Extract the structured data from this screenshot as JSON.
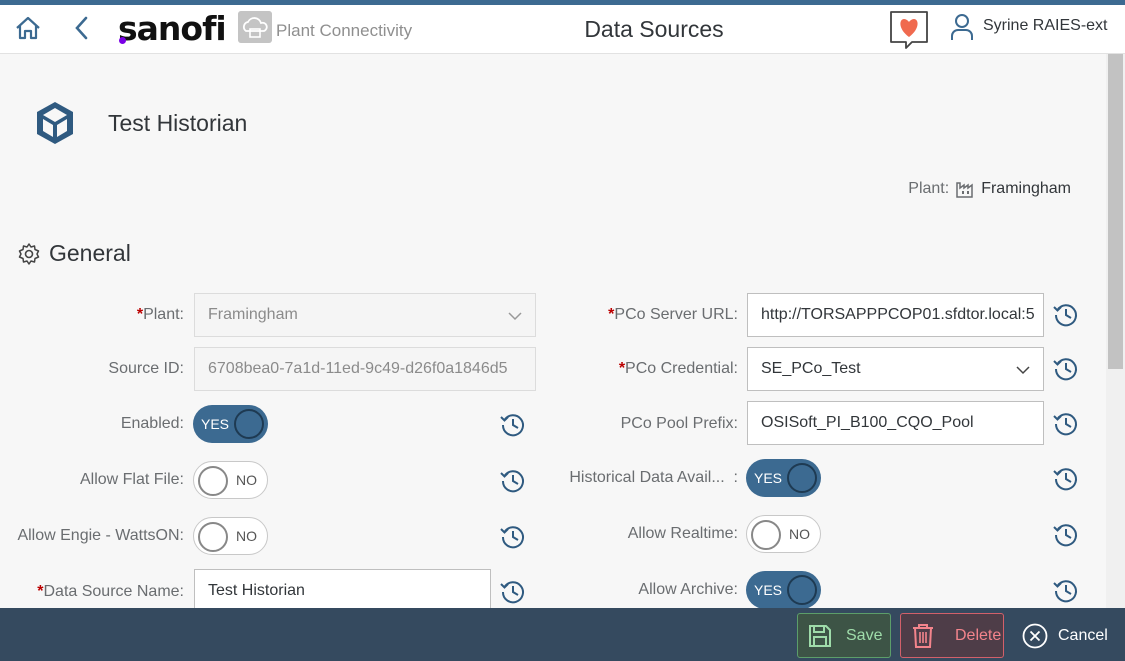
{
  "header": {
    "logo_text": "sanofi",
    "app_name": "Plant Connectivity",
    "title": "Data Sources",
    "user_name": "Syrine RAIES-ext"
  },
  "object": {
    "title": "Test Historian",
    "plant_label": "Plant:",
    "plant_value": "Framingham"
  },
  "section": {
    "title": "General"
  },
  "left_fields": {
    "plant": {
      "label": "Plant:",
      "value": "Framingham"
    },
    "source_id": {
      "label": "Source ID:",
      "value": "6708bea0-7a1d-11ed-9c49-d26f0a1846d5"
    },
    "enabled": {
      "label": "Enabled:",
      "state": "YES"
    },
    "allow_flat_file": {
      "label": "Allow Flat File:",
      "state": "NO"
    },
    "allow_engie": {
      "label": "Allow Engie - WattsON:",
      "state": "NO"
    },
    "data_source_name": {
      "label": "Data Source Name:",
      "value": "Test Historian"
    }
  },
  "right_fields": {
    "pco_server_url": {
      "label": "PCo Server URL:",
      "value": "http://TORSAPPPCOP01.sfdtor.local:5"
    },
    "pco_credential": {
      "label": "PCo Credential:",
      "value": "SE_PCo_Test"
    },
    "pco_pool_prefix": {
      "label": "PCo Pool Prefix:",
      "value": "OSISoft_PI_B100_CQO_Pool"
    },
    "historical_data": {
      "label": "Historical Data Avail...",
      "colon": ":",
      "state": "YES"
    },
    "allow_realtime": {
      "label": "Allow Realtime:",
      "state": "NO"
    },
    "allow_archive": {
      "label": "Allow Archive:",
      "state": "YES"
    }
  },
  "required_marker": "*",
  "footer": {
    "save_label": "Save",
    "delete_label": "Delete",
    "cancel_label": "Cancel"
  },
  "colors": {
    "brand_bar": "#3c6a91",
    "footer_bg": "#354a5f",
    "save_accent": "#9fdcaa",
    "delete_accent": "#f3848c"
  }
}
